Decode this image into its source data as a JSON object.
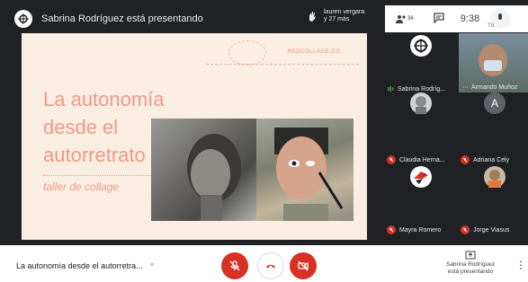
{
  "topbar": {
    "presenting": "Sabrina Rodríguez está presentando"
  },
  "viewers": {
    "line1": "lauren vergara",
    "line2": "y 27 más"
  },
  "top_right": {
    "people_count": "36",
    "time": "9:38",
    "self_label": "Tú"
  },
  "slide": {
    "handle": "REDCOLLAGE.CO",
    "title": "La autonomía\ndesde el\nautorretrato",
    "subtitle": "taller  de collage"
  },
  "participants": [
    {
      "name": "Sabrina Rodríg...",
      "muted": false
    },
    {
      "name": "Armando Muñoz",
      "muted": false
    },
    {
      "name": "Claudia Herna...",
      "muted": true
    },
    {
      "name": "Adriana Cely",
      "muted": true,
      "initial": "A"
    },
    {
      "name": "Mayra Romero",
      "muted": true
    },
    {
      "name": "Jorge Viasus",
      "muted": true
    }
  ],
  "bottom": {
    "meeting_title": "La autonomía desde el autorretra...",
    "presenting_line1": "Sabrina Rodríguez",
    "presenting_line2": "está presentando"
  },
  "colors": {
    "red": "#d93025",
    "slide_bg": "#faeee3",
    "slide_text": "#ee9a86",
    "dark": "#202124"
  }
}
